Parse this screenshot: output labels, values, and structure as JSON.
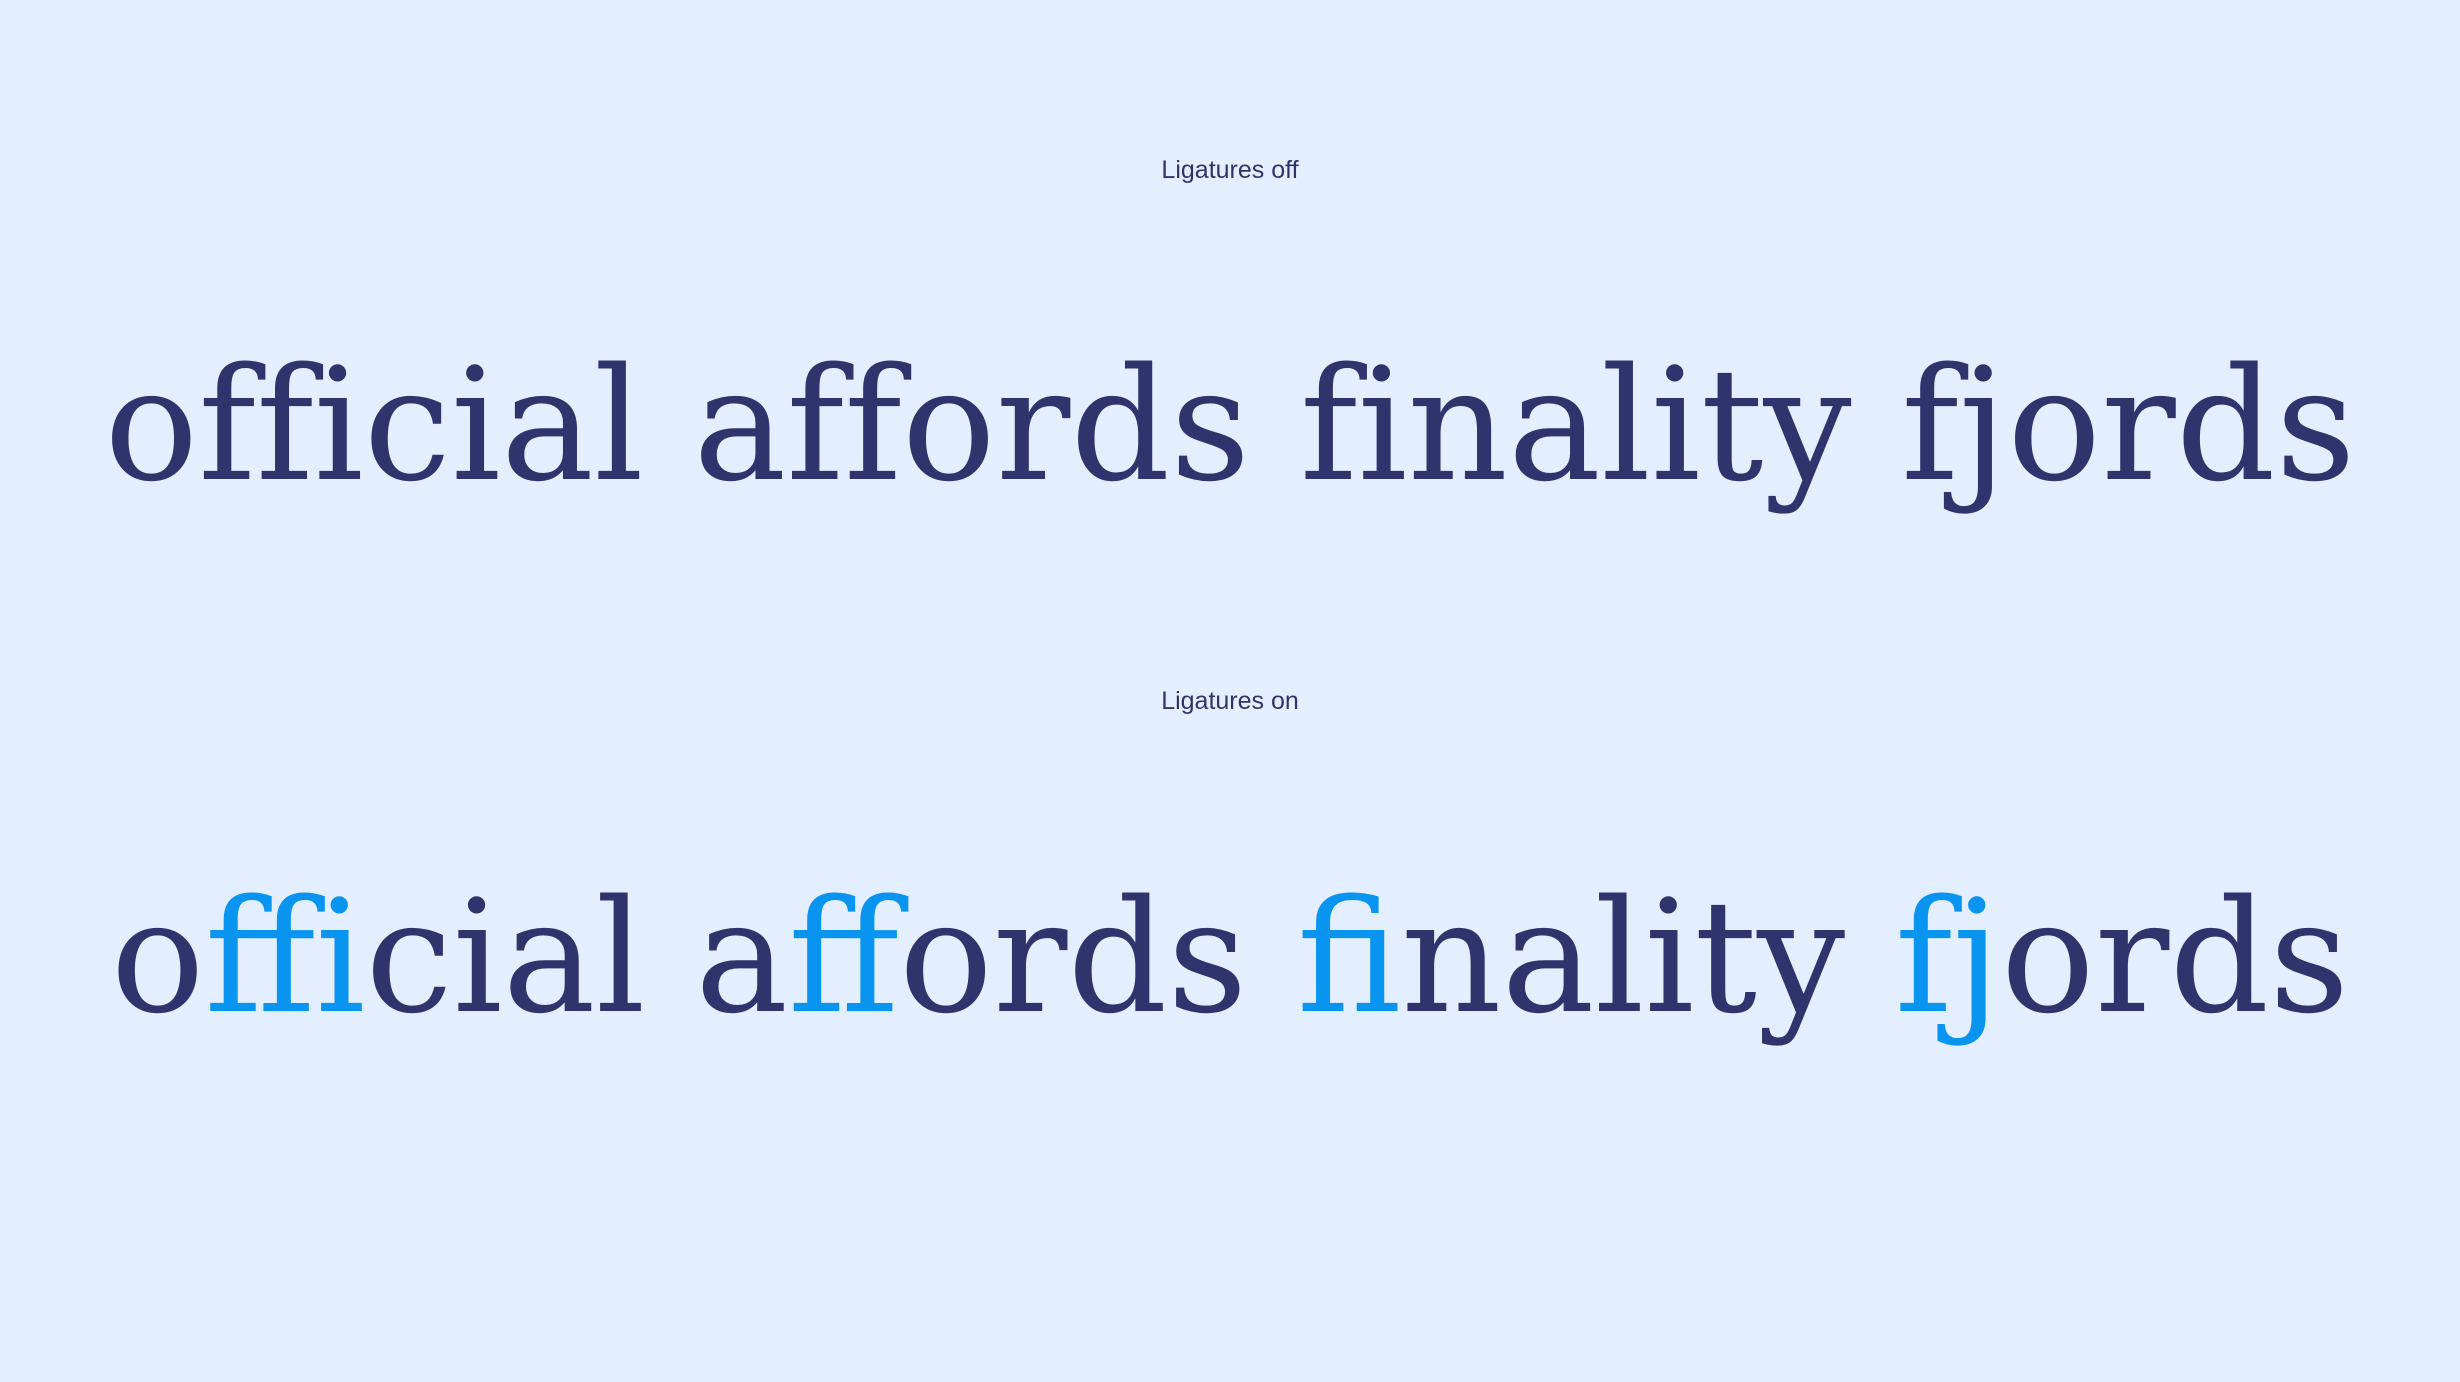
{
  "labels": {
    "off": "Ligatures off",
    "on": "Ligatures on"
  },
  "sample_off": {
    "text": "official affords finality fjords"
  },
  "sample_on": {
    "words": [
      {
        "pre": "o",
        "lig": "ffi",
        "post": "cial"
      },
      {
        "pre": "a",
        "lig": "ff",
        "post": "ords"
      },
      {
        "pre": "",
        "lig": "fi",
        "post": "nality"
      },
      {
        "pre": "",
        "lig": "fj",
        "post": "ords"
      }
    ]
  },
  "colors": {
    "background": "#e3eeff",
    "text": "#2e356d",
    "ligature_highlight": "#0994ef"
  }
}
